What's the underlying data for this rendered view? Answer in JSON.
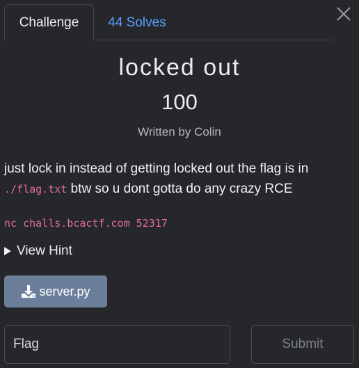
{
  "tabs": {
    "challenge": "Challenge",
    "solves": "44 Solves"
  },
  "challenge": {
    "title": "locked out",
    "points": "100",
    "author": "Written by Colin"
  },
  "description": {
    "part1": "just lock in instead of getting locked out the flag is in",
    "code": "./flag.txt",
    "part2": "btw so u dont gotta do any crazy RCE",
    "connection": "nc challs.bcactf.com 52317"
  },
  "hint": {
    "label": "View Hint"
  },
  "files": {
    "download_label": "server.py"
  },
  "form": {
    "flag_placeholder": "Flag",
    "submit_label": "Submit"
  },
  "colors": {
    "background": "#25272b",
    "link": "#5aa2ff",
    "code": "#e06c9f",
    "download_button": "#6c7f9a"
  },
  "icons": {
    "close": "close-icon",
    "hint": "triangle-right-icon",
    "download": "download-icon"
  }
}
